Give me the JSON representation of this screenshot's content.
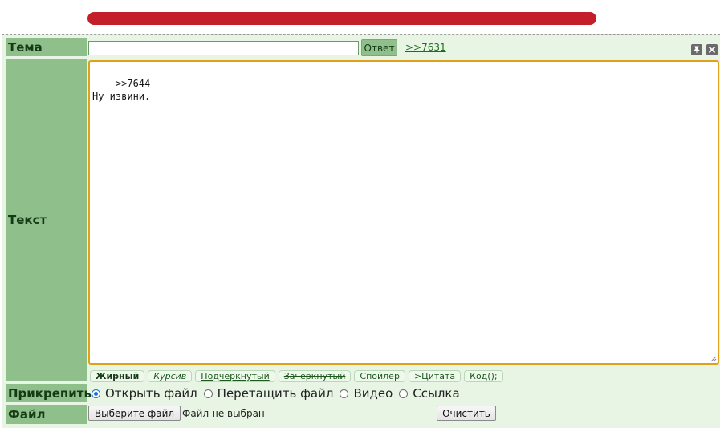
{
  "header": {
    "accent": "#c41e2a"
  },
  "colors": {
    "label_bg": "#8fbf8a",
    "panel_bg": "#e8f5e4",
    "focus_border": "#e0a018",
    "link": "#1d6e1d"
  },
  "form": {
    "subject": {
      "label": "Тема",
      "value": "",
      "reply_button": "Ответ",
      "reply_ref": ">>7631"
    },
    "icons": {
      "pin": "pin-icon",
      "close": "close-icon"
    },
    "text": {
      "label": "Текст",
      "value": ">>7644\nНу извини."
    },
    "markup": [
      {
        "label": "Жирный"
      },
      {
        "label": "Курсив"
      },
      {
        "label": "Подчёркнутый"
      },
      {
        "label": "Зачёркнутый"
      },
      {
        "label": "Спойлер"
      },
      {
        "label": ">Цитата"
      },
      {
        "label": "Код();"
      }
    ],
    "attach": {
      "label": "Прикрепить",
      "options": [
        {
          "label": "Открыть файл",
          "checked": true
        },
        {
          "label": "Перетащить файл",
          "checked": false
        },
        {
          "label": "Видео",
          "checked": false
        },
        {
          "label": "Ссылка",
          "checked": false
        }
      ]
    },
    "file": {
      "label": "Файл",
      "choose_button": "Выберите файл",
      "status": "Файл не выбран",
      "clear_button": "Очистить"
    }
  }
}
